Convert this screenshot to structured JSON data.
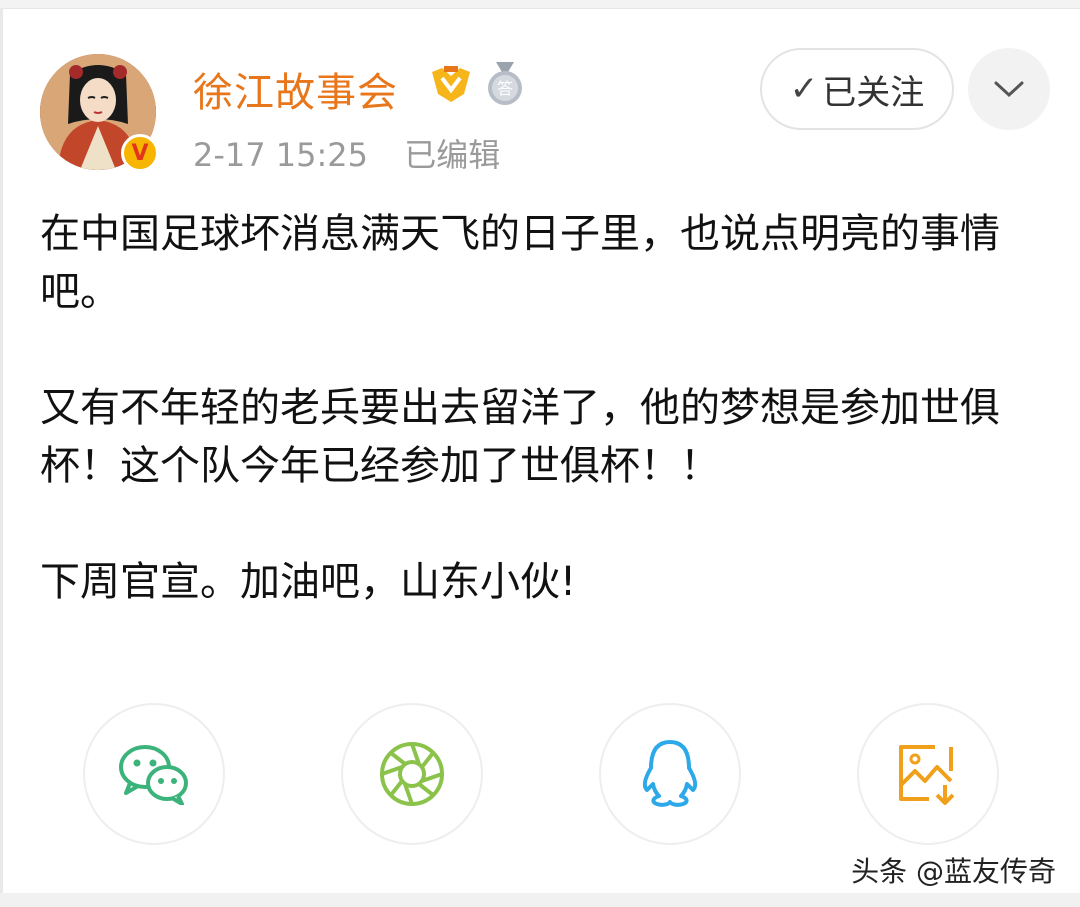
{
  "post": {
    "username": "徐江故事会",
    "time": "2-17 15:25",
    "edited": "已编辑",
    "follow_label": "已关注",
    "verified_badge": "V",
    "paragraphs": [
      "在中国足球坏消息满天飞的日子里，也说点明亮的事情吧。",
      "又有不年轻的老兵要出去留洋了，他的梦想是参加世俱杯！这个队今年已经参加了世俱杯！！",
      "下周官宣。加油吧，山东小伙!"
    ]
  },
  "share_targets": [
    {
      "icon": "wechat-icon",
      "color": "#3bb37a"
    },
    {
      "icon": "moments-icon",
      "color": "#8bc34a"
    },
    {
      "icon": "qq-icon",
      "color": "#2da8e8"
    },
    {
      "icon": "save-image-icon",
      "color": "#f0a01a"
    }
  ],
  "watermark": "头条 @蓝友传奇",
  "colors": {
    "username": "#e8761b",
    "meta": "#9a9a9a"
  }
}
